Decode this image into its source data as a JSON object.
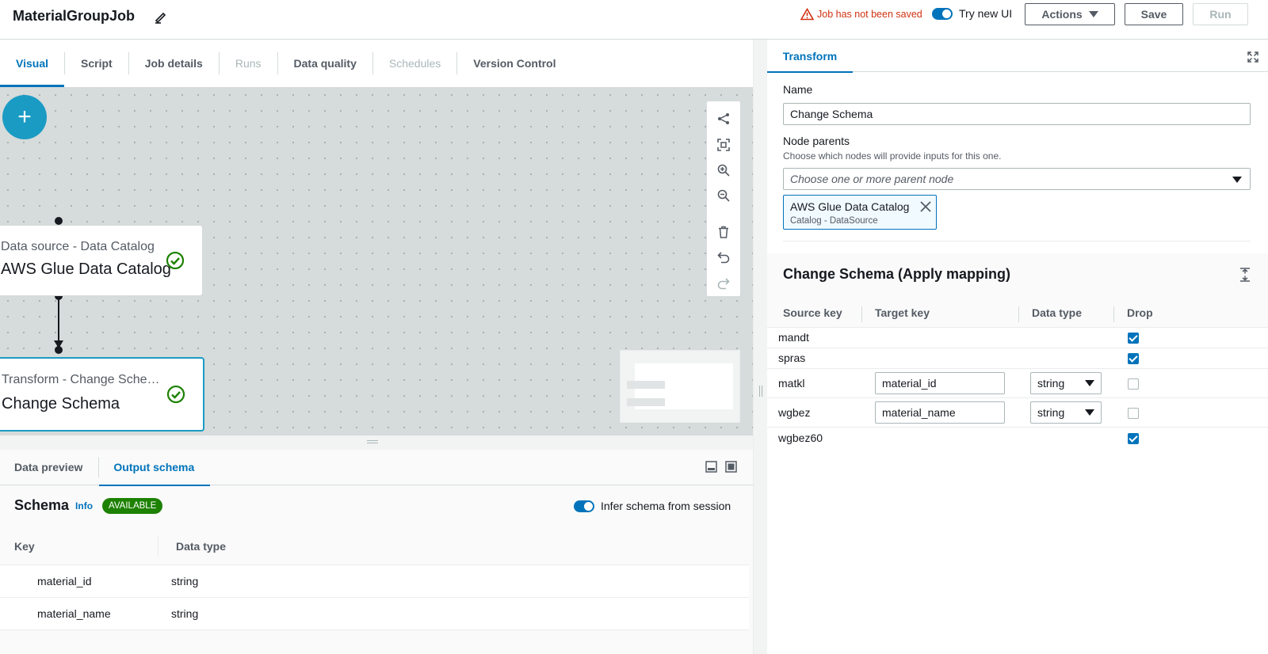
{
  "header": {
    "job_title": "MaterialGroupJob",
    "warning": "Job has not been saved",
    "try_new_ui": "Try new UI",
    "actions_label": "Actions",
    "save_label": "Save",
    "run_label": "Run"
  },
  "tabs": [
    {
      "label": "Visual",
      "state": "active"
    },
    {
      "label": "Script",
      "state": "normal"
    },
    {
      "label": "Job details",
      "state": "normal"
    },
    {
      "label": "Runs",
      "state": "disabled"
    },
    {
      "label": "Data quality",
      "state": "normal"
    },
    {
      "label": "Schedules",
      "state": "disabled"
    },
    {
      "label": "Version Control",
      "state": "normal"
    }
  ],
  "canvas": {
    "add_button": "+",
    "nodes": [
      {
        "subtitle": "Data source - Data Catalog",
        "title": "AWS Glue Data Catalog"
      },
      {
        "subtitle": "Transform - Change Sche…",
        "title": "Change Schema"
      }
    ],
    "toolbar": [
      "layout-icon",
      "fit-view-icon",
      "zoom-in-icon",
      "zoom-out-icon",
      "delete-icon",
      "undo-icon",
      "redo-icon"
    ]
  },
  "bottom_panel": {
    "tabs": [
      {
        "label": "Data preview",
        "active": false
      },
      {
        "label": "Output schema",
        "active": true
      }
    ],
    "schema_title": "Schema",
    "info_link": "Info",
    "status_badge": "AVAILABLE",
    "infer_label": "Infer schema from session",
    "columns": [
      "Key",
      "Data type"
    ],
    "rows": [
      {
        "key": "material_id",
        "type": "string"
      },
      {
        "key": "material_name",
        "type": "string"
      }
    ]
  },
  "right_panel": {
    "tab_label": "Transform",
    "name_label": "Name",
    "name_value": "Change Schema",
    "parents_label": "Node parents",
    "parents_desc": "Choose which nodes will provide inputs for this one.",
    "parents_placeholder": "Choose one or more parent node",
    "token_title": "AWS Glue Data Catalog",
    "token_subtitle": "Catalog - DataSource",
    "section_title": "Change Schema (Apply mapping)",
    "columns": [
      "Source key",
      "Target key",
      "Data type",
      "Drop"
    ],
    "mappings": [
      {
        "source": "mandt",
        "target": "",
        "type": "",
        "drop": true
      },
      {
        "source": "spras",
        "target": "",
        "type": "",
        "drop": true
      },
      {
        "source": "matkl",
        "target": "material_id",
        "type": "string",
        "drop": false
      },
      {
        "source": "wgbez",
        "target": "material_name",
        "type": "string",
        "drop": false
      },
      {
        "source": "wgbez60",
        "target": "",
        "type": "",
        "drop": true
      }
    ]
  },
  "colors": {
    "accent": "#0073bb",
    "canvas_bg": "#d6dbdb",
    "add_button": "#1a9bc4",
    "success": "#1d8102",
    "warning": "#d13212"
  }
}
